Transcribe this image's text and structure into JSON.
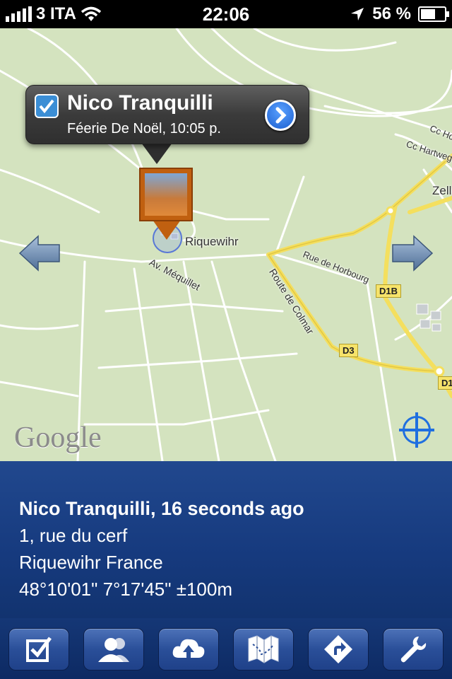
{
  "status_bar": {
    "carrier": "3 ITA",
    "time": "22:06",
    "battery_percent": "56 %",
    "battery_level": 0.56,
    "icons": [
      "signal-bars-icon",
      "wifi-icon",
      "location-arrow-icon",
      "battery-icon"
    ]
  },
  "map": {
    "labels": {
      "riquewihr": "Riquewihr",
      "av_mequillet": "Av. Méquillet",
      "rue_horbourg": "Rue de Horbourg",
      "route_colmar": "Route de Colmar",
      "cc_ho": "Cc Ho",
      "cc_hartweg": "Cc Hartweg",
      "zelle": "Zelle",
      "d1b": "D1B",
      "d3": "D3",
      "d1": "D1"
    },
    "attribution": "Google",
    "colors": {
      "land": "#d4e3bf",
      "road": "#ffffff",
      "highway": "#f4df5e"
    }
  },
  "callout": {
    "title": "Nico Tranquilli",
    "subtitle": "Féerie De Noël, 10:05 p."
  },
  "info": {
    "title": "Nico Tranquilli, 16 seconds ago",
    "address": "1, rue du cerf",
    "city": "Riquewihr France",
    "coords": "48°10'01\"  7°17'45\"  ±100m"
  },
  "tabbar": {
    "items": [
      "checkin-icon",
      "friends-icon",
      "upload-cloud-icon",
      "map-icon",
      "directions-icon",
      "settings-wrench-icon"
    ]
  }
}
